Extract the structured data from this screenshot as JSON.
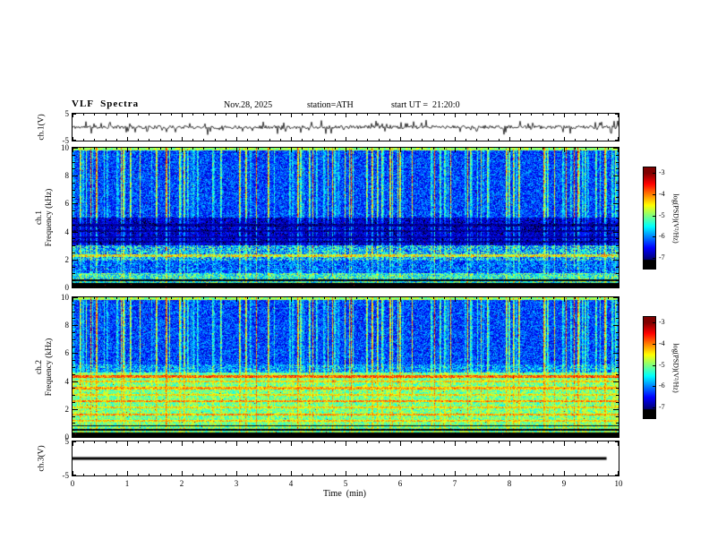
{
  "header": {
    "title": "VLF  Spectra",
    "date": "Nov.28, 2025",
    "station": "station=ATH",
    "start_ut": "start UT =  21:20:0"
  },
  "axes": {
    "time_label": "Time  (min)",
    "time_ticks": [
      0,
      1,
      2,
      3,
      4,
      5,
      6,
      7,
      8,
      9,
      10
    ],
    "time_minor_step": 0.2,
    "freq_label": "Frequency  (kHz)",
    "freq_ticks": [
      0,
      2,
      4,
      6,
      8,
      10
    ],
    "freq_minor_step": 0.5,
    "volt_ticks": [
      5,
      -5
    ]
  },
  "panels": {
    "ch1_wave": {
      "label": "ch.1(V)"
    },
    "ch1_spec": {
      "row_label": "ch.1"
    },
    "ch2_spec": {
      "row_label": "ch.2"
    },
    "ch3_wave": {
      "label": "ch.3(V)"
    }
  },
  "colorbar": {
    "label": "log(PSD)(V²/Hz)",
    "ticks": [
      -3,
      -4,
      -5,
      -6,
      -7
    ],
    "vmin": -7,
    "vmax": -3,
    "bar_range": [
      -7.5,
      -2.75
    ],
    "colormap": "jet"
  },
  "chart_data": [
    {
      "type": "line",
      "name": "ch1_waveform",
      "ylabel": "ch.1(V)",
      "ylim": [
        -5,
        5
      ],
      "xlim": [
        0,
        10
      ],
      "description": "broadband noisy voltage trace with impulsive sferic spikes around 0 V",
      "gen": {
        "seed": 11,
        "noise_amp": 0.6,
        "spike_prob": 0.12,
        "spike_amp": 2.4
      }
    },
    {
      "type": "heatmap",
      "name": "ch1_spectrogram",
      "xlabel": "Time (min)",
      "ylabel": "ch.1 Frequency (kHz)",
      "zlabel": "log(PSD)(V²/Hz)",
      "xlim": [
        0,
        10
      ],
      "ylim": [
        0,
        10
      ],
      "zlim": [
        -7,
        -3
      ],
      "colormap": "jet",
      "description": "blue background PSD with dense vertical sferic streaks, green speckle band near 2-3 kHz, dark hum lines 3-4.5 kHz, green band below 1 kHz, black band at 0 kHz",
      "gen": {
        "seed": 23,
        "streak_seed": 7,
        "streak_prob": 0.27,
        "streak_amp": [
          0.4,
          2.2
        ],
        "bands": [
          {
            "f": [
              5.0,
              10.0
            ],
            "base": -6.25,
            "noise": 0.55,
            "streak": 1.0
          },
          {
            "f": [
              3.0,
              5.0
            ],
            "base": -6.7,
            "noise": 0.45,
            "streak": 0.55
          },
          {
            "f": [
              1.9,
              3.0
            ],
            "base": -5.75,
            "noise": 0.9,
            "streak": 0.6
          },
          {
            "f": [
              1.0,
              1.9
            ],
            "base": -6.15,
            "noise": 0.7,
            "streak": 0.5
          },
          {
            "f": [
              0.3,
              1.0
            ],
            "base": -5.4,
            "noise": 0.8,
            "streak": 0.4
          },
          {
            "f": [
              0.0,
              0.3
            ],
            "base": -7.5,
            "noise": 0.15,
            "streak": 0.0
          }
        ],
        "lines": [
          {
            "f": 4.45,
            "w": 0.07,
            "mode": "set",
            "value": -6.9
          },
          {
            "f": 4.05,
            "w": 0.07,
            "mode": "set",
            "value": -6.9
          },
          {
            "f": 3.6,
            "w": 0.07,
            "mode": "set",
            "value": -6.85
          },
          {
            "f": 3.25,
            "w": 0.07,
            "mode": "set",
            "value": -6.9
          },
          {
            "f": 2.25,
            "w": 0.1,
            "mode": "max",
            "value": -4.6,
            "speckle": 0.8
          },
          {
            "f": 0.5,
            "w": 0.05,
            "mode": "set",
            "value": -7.2
          },
          {
            "f": 9.93,
            "w": 0.12,
            "mode": "max",
            "value": -4.9,
            "speckle": 0.5
          }
        ],
        "red_speck_prob": 0.0015
      }
    },
    {
      "type": "heatmap",
      "name": "ch2_spectrogram",
      "xlabel": "Time (min)",
      "ylabel": "ch.2 Frequency (kHz)",
      "zlabel": "log(PSD)(V²/Hz)",
      "xlim": [
        0,
        10
      ],
      "ylim": [
        0,
        10
      ],
      "zlim": [
        -7,
        -3
      ],
      "colormap": "jet",
      "description": "blue with sferic streaks above 5 kHz, broad green zone below 4.6 kHz with yellow/orange hum lines, black lines near 0.5-0.8 kHz, black band at 0 kHz",
      "gen": {
        "seed": 57,
        "streak_seed": 7,
        "streak_prob": 0.27,
        "streak_amp": [
          0.4,
          2.2
        ],
        "bands": [
          {
            "f": [
              5.2,
              10.0
            ],
            "base": -6.25,
            "noise": 0.55,
            "streak": 1.0
          },
          {
            "f": [
              4.6,
              5.2
            ],
            "base": -5.9,
            "noise": 0.7,
            "streak": 0.8
          },
          {
            "f": [
              0.3,
              4.6
            ],
            "base": -5.05,
            "noise": 0.55,
            "streak": 0.45
          },
          {
            "f": [
              0.0,
              0.3
            ],
            "base": -7.5,
            "noise": 0.15,
            "streak": 0.0
          }
        ],
        "lines": [
          {
            "f": 4.35,
            "w": 0.09,
            "mode": "max",
            "value": -3.9,
            "speckle": 0.5
          },
          {
            "f": 3.95,
            "w": 0.07,
            "mode": "max",
            "value": -4.4,
            "speckle": 0.5
          },
          {
            "f": 3.5,
            "w": 0.08,
            "mode": "max",
            "value": -4.2,
            "speckle": 0.5
          },
          {
            "f": 3.0,
            "w": 0.07,
            "mode": "max",
            "value": -4.45,
            "speckle": 0.5
          },
          {
            "f": 2.55,
            "w": 0.08,
            "mode": "max",
            "value": -4.1,
            "speckle": 0.5
          },
          {
            "f": 2.1,
            "w": 0.07,
            "mode": "max",
            "value": -4.4,
            "speckle": 0.5
          },
          {
            "f": 1.6,
            "w": 0.08,
            "mode": "max",
            "value": -4.15,
            "speckle": 0.5
          },
          {
            "f": 1.15,
            "w": 0.07,
            "mode": "max",
            "value": -4.4,
            "speckle": 0.5
          },
          {
            "f": 0.8,
            "w": 0.05,
            "mode": "set",
            "value": -7.2
          },
          {
            "f": 0.5,
            "w": 0.05,
            "mode": "set",
            "value": -7.2
          },
          {
            "f": 9.93,
            "w": 0.12,
            "mode": "max",
            "value": -4.9,
            "speckle": 0.5
          }
        ],
        "red_speck_prob": 0.002
      }
    },
    {
      "type": "line",
      "name": "ch3_waveform",
      "ylabel": "ch.3(V)",
      "ylim": [
        -5,
        5
      ],
      "xlim": [
        0,
        10
      ],
      "description": "flat thick line at 0 V (no signal)",
      "gen": {
        "flat_value": 0,
        "thickness": 3
      }
    }
  ]
}
